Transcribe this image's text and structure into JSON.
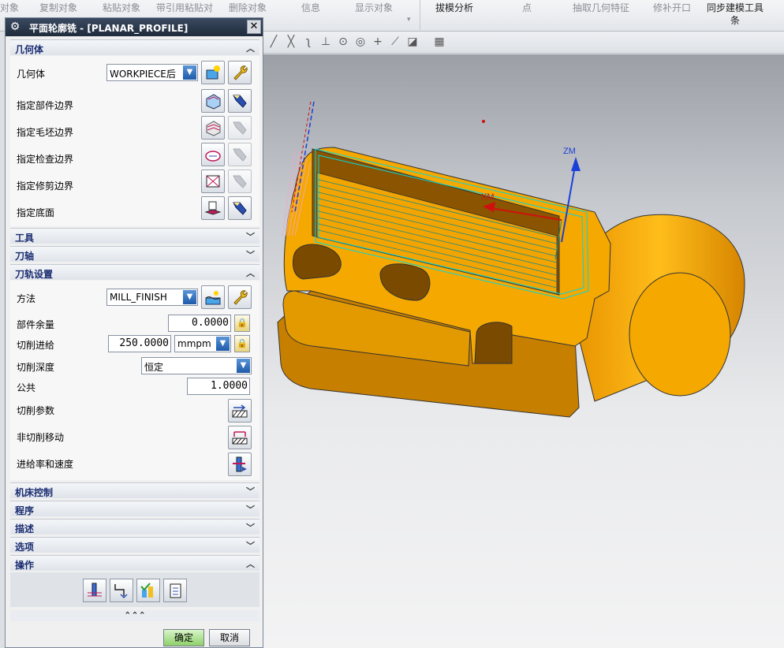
{
  "ribbon": {
    "items": [
      "对象",
      "复制对象",
      "粘贴对象",
      "带引用粘贴对",
      "删除对象",
      "信息",
      "显示对象",
      "拔模分析",
      "点",
      "抽取几何特征",
      "修补开口",
      "同步建模工具",
      "条"
    ]
  },
  "dialog": {
    "title": "平面轮廓铣 - [PLANAR_PROFILE]",
    "close_label": "✕",
    "sections": {
      "geometry": {
        "header": "几何体",
        "geometry_label": "几何体",
        "geometry_value": "WORKPIECE后",
        "part_boundary": "指定部件边界",
        "blank_boundary": "指定毛坯边界",
        "check_boundary": "指定检查边界",
        "trim_boundary": "指定修剪边界",
        "floor": "指定底面"
      },
      "tool": {
        "header": "工具"
      },
      "tool_axis": {
        "header": "刀轴"
      },
      "path_settings": {
        "header": "刀轨设置",
        "method_label": "方法",
        "method_value": "MILL_FINISH",
        "part_stock_label": "部件余量",
        "part_stock_value": "0.0000",
        "stepover_label": "切削进给",
        "stepover_value": "250.0000",
        "stepover_unit": "mmpm",
        "cut_depth_label": "切削深度",
        "cut_depth_value": "恒定",
        "common_label": "公共",
        "common_value": "1.0000",
        "cut_params_label": "切削参数",
        "non_cut_label": "非切削移动",
        "feeds_label": "进给率和速度"
      },
      "machine_control": {
        "header": "机床控制"
      },
      "program": {
        "header": "程序"
      },
      "description": {
        "header": "描述"
      },
      "options": {
        "header": "选项"
      },
      "actions": {
        "header": "操作"
      }
    },
    "collapse_glyph": "⌃⌃⌃",
    "ok_label": "确定",
    "cancel_label": "取消"
  },
  "viewport": {
    "axis_z": "ZM",
    "axis_x": "XM"
  },
  "colors": {
    "part": "#f5a800",
    "toolpath": "#00d8e0",
    "axis_z": "#1a3fd8",
    "axis_x": "#d01010"
  }
}
